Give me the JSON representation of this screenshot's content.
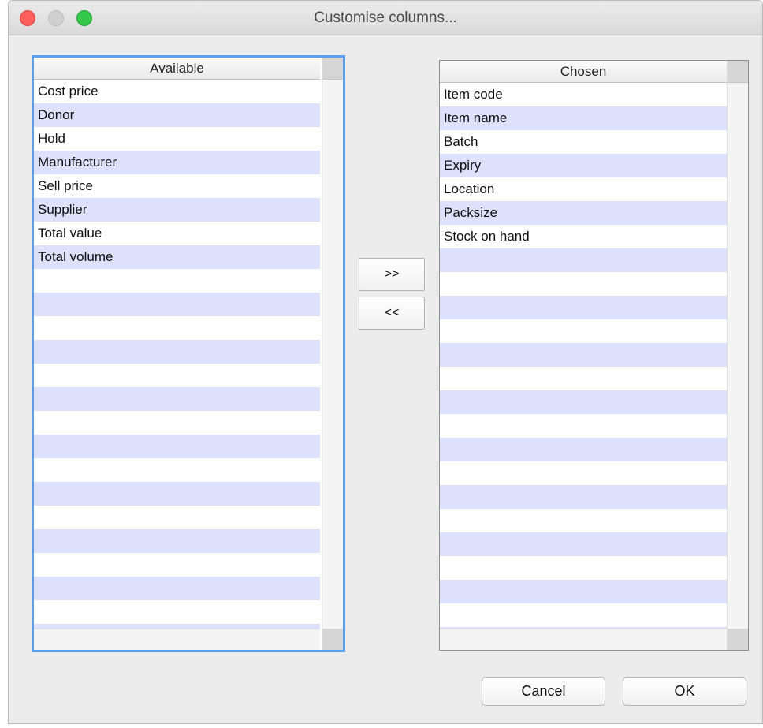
{
  "window": {
    "title": "Customise columns..."
  },
  "available": {
    "header": "Available",
    "items": [
      "Cost price",
      "Donor",
      "Hold",
      "Manufacturer",
      "Sell price",
      "Supplier",
      "Total value",
      "Total volume"
    ],
    "empty_rows": 16
  },
  "chosen": {
    "header": "Chosen",
    "items": [
      "Item code",
      "Item name",
      "Batch",
      "Expiry",
      "Location",
      "Packsize",
      "Stock on hand"
    ],
    "empty_rows": 17
  },
  "controls": {
    "add_label": ">>",
    "remove_label": "<<",
    "cancel_label": "Cancel",
    "ok_label": "OK"
  },
  "colors": {
    "stripe": "#dde1fc",
    "focus_border": "#5aa0f0",
    "close": "#fc605c",
    "maximize": "#34c84a"
  }
}
